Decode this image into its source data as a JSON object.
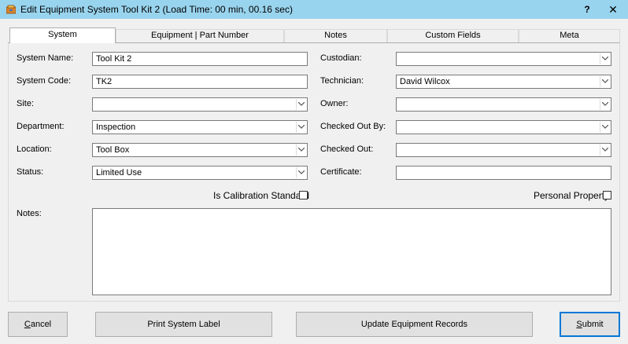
{
  "window": {
    "title": "Edit Equipment System Tool Kit 2 (Load Time: 00 min, 00.16 sec)",
    "help_label": "?",
    "close_label": "✕"
  },
  "tabs": [
    {
      "label": "System",
      "active": true
    },
    {
      "label": "Equipment | Part Number",
      "active": false
    },
    {
      "label": "Notes",
      "active": false
    },
    {
      "label": "Custom Fields",
      "active": false
    },
    {
      "label": "Meta",
      "active": false
    }
  ],
  "form": {
    "system_name": {
      "label": "System Name:",
      "value": "Tool Kit 2"
    },
    "system_code": {
      "label": "System Code:",
      "value": "TK2"
    },
    "site": {
      "label": "Site:",
      "value": ""
    },
    "department": {
      "label": "Department:",
      "value": "Inspection"
    },
    "location": {
      "label": "Location:",
      "value": "Tool Box"
    },
    "status": {
      "label": "Status:",
      "value": "Limited Use"
    },
    "custodian": {
      "label": "Custodian:",
      "value": ""
    },
    "technician": {
      "label": "Technician:",
      "value": "David Wilcox"
    },
    "owner": {
      "label": "Owner:",
      "value": ""
    },
    "checked_out_by": {
      "label": "Checked Out By:",
      "value": ""
    },
    "checked_out": {
      "label": "Checked Out:",
      "value": ""
    },
    "certificate": {
      "label": "Certificate:",
      "value": ""
    },
    "is_calibration_standard": {
      "label": "Is Calibration Standard",
      "checked": false
    },
    "personal_property": {
      "label": "Personal Property",
      "checked": false
    },
    "notes": {
      "label": "Notes:",
      "value": ""
    }
  },
  "buttons": {
    "cancel_first": "C",
    "cancel_rest": "ancel",
    "print_label": "Print System Label",
    "update_records": "Update Equipment Records",
    "submit_first": "S",
    "submit_rest": "ubmit"
  },
  "colors": {
    "titlebar": "#99d4ee",
    "default_button_border": "#0078d7"
  }
}
